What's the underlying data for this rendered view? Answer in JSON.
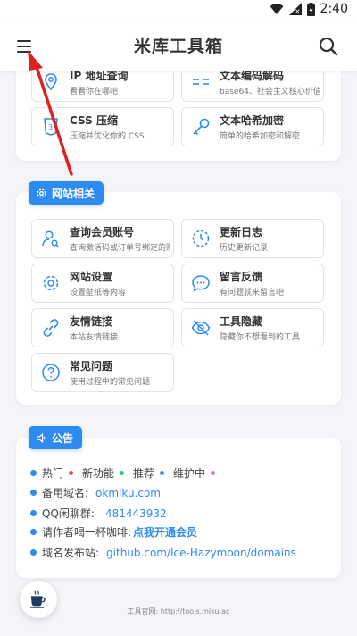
{
  "status_bar": {
    "time": "2:40"
  },
  "header": {
    "title": "米库工具箱"
  },
  "tools_top": [
    {
      "name": "IP 地址查询",
      "desc": "看看你在哪吧",
      "icon": "location-icon"
    },
    {
      "name": "文本编码解码",
      "desc": "base64、社会主义核心价值观编码",
      "icon": "equals-icon"
    },
    {
      "name": "CSS 压缩",
      "desc": "压缩并优化你的 CSS",
      "icon": "css3-icon"
    },
    {
      "name": "文本哈希加密",
      "desc": "简单的哈希加密和解密",
      "icon": "key-icon"
    }
  ],
  "website": {
    "badge": "网站相关",
    "tools": [
      {
        "name": "查询会员账号",
        "desc": "查询激活码或订单号绑定的账号",
        "icon": "user-search-icon"
      },
      {
        "name": "更新日志",
        "desc": "历史更新记录",
        "icon": "history-icon"
      },
      {
        "name": "网站设置",
        "desc": "设置壁纸等内容",
        "icon": "gear-icon"
      },
      {
        "name": "留言反馈",
        "desc": "有问题就来留言吧",
        "icon": "chat-icon"
      },
      {
        "name": "友情链接",
        "desc": "本站友情链接",
        "icon": "link-icon"
      },
      {
        "name": "工具隐藏",
        "desc": "隐藏你不想看到的工具",
        "icon": "eye-off-icon"
      },
      {
        "name": "常见问题",
        "desc": "使用过程中的常见问题",
        "icon": "question-icon"
      }
    ]
  },
  "notice": {
    "badge": "公告",
    "legend": [
      {
        "label": "热门",
        "color": "#e8455b"
      },
      {
        "label": "新功能",
        "color": "#2ecc71"
      },
      {
        "label": "推荐",
        "color": "#2e8bf0"
      },
      {
        "label": "维护中",
        "color": "#c77ddb"
      }
    ],
    "backup_domain_label": "备用域名:",
    "backup_domain": "okmiku.com",
    "qq_group_label": "QQ闲聊群:",
    "qq_group": "481443932",
    "coffee_text": "请作者喝一杯咖啡:",
    "coffee_link": "点我开通会员",
    "domain_publish_label": "域名发布站:",
    "domain_publish": "github.com/Ice-Hazymoon/domains"
  },
  "footer": {
    "text": "工具官网:  http://tools.miku.ac"
  },
  "colors": {
    "accent": "#2e8bf0",
    "bg": "#f4f5f9",
    "card": "#ffffff"
  }
}
